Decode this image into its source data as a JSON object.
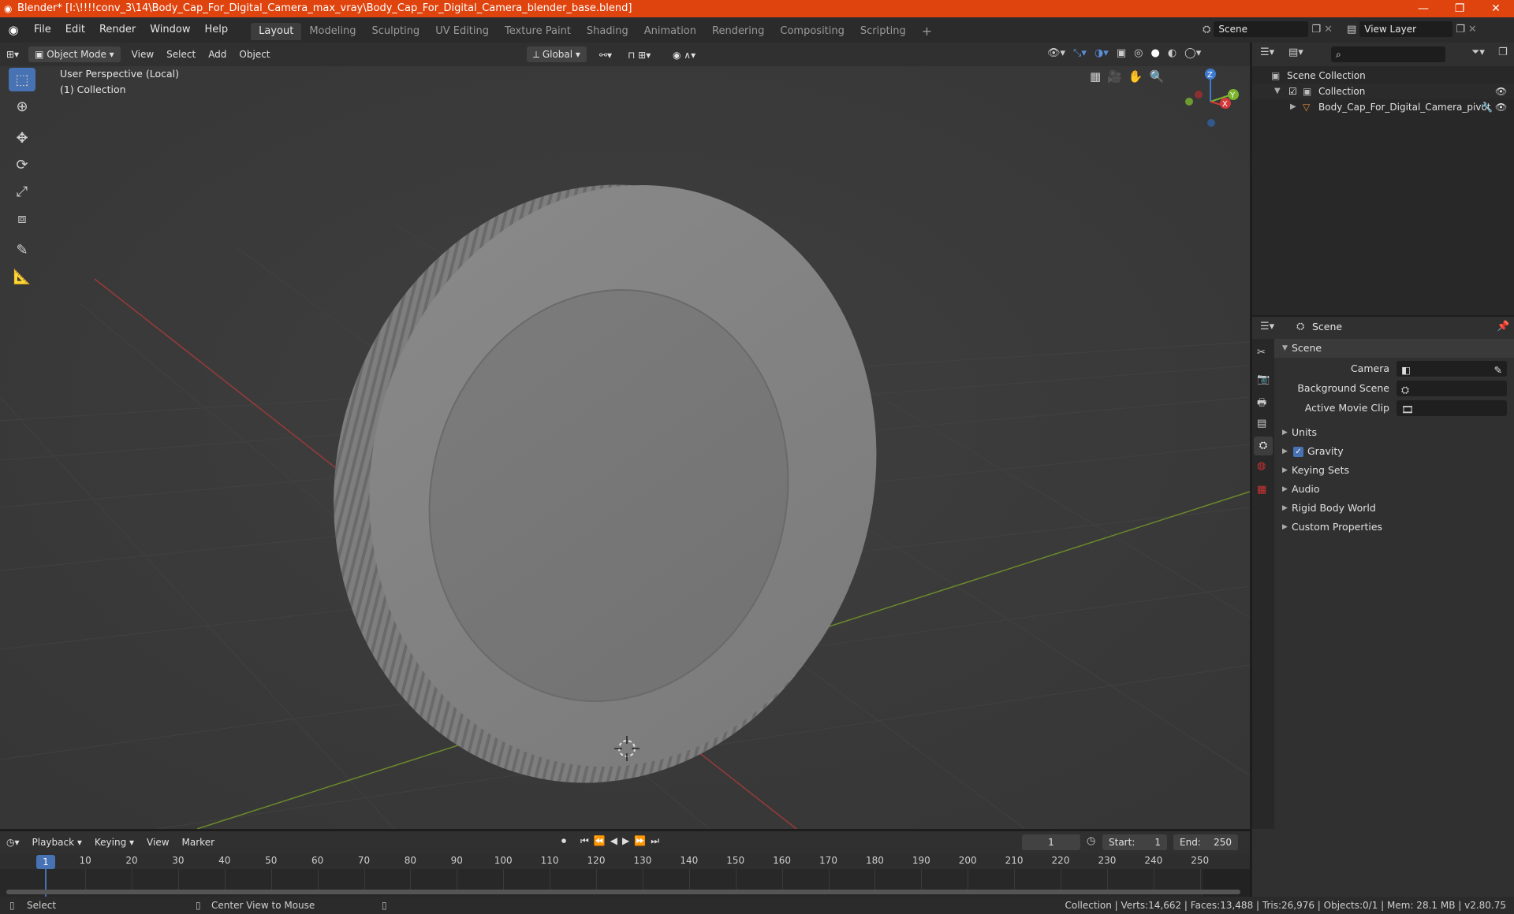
{
  "window": {
    "title": "Blender* [I:\\!!!!conv_3\\14\\Body_Cap_For_Digital_Camera_max_vray\\Body_Cap_For_Digital_Camera_blender_base.blend]",
    "minimize": "—",
    "restore": "❐",
    "close": "✕"
  },
  "menu": {
    "items": [
      "File",
      "Edit",
      "Render",
      "Window",
      "Help"
    ]
  },
  "workspaces": [
    "Layout",
    "Modeling",
    "Sculpting",
    "UV Editing",
    "Texture Paint",
    "Shading",
    "Animation",
    "Rendering",
    "Compositing",
    "Scripting"
  ],
  "scene_field": "Scene",
  "view_layer_field": "View Layer",
  "viewport_header": {
    "mode": "Object Mode",
    "menus": [
      "View",
      "Select",
      "Add",
      "Object"
    ],
    "transform": "Global"
  },
  "viewport": {
    "perspective": "User Perspective (Local)",
    "collection": "(1) Collection",
    "gizmo": {
      "z": "Z",
      "y": "Y",
      "x": "X"
    }
  },
  "outliner": {
    "root": "Scene Collection",
    "collection": "Collection",
    "object": "Body_Cap_For_Digital_Camera_pivot"
  },
  "properties": {
    "header": "Scene",
    "panel": "Scene",
    "camera_label": "Camera",
    "background_label": "Background Scene",
    "movie_clip_label": "Active Movie Clip",
    "sections": [
      "Units",
      "Gravity",
      "Keying Sets",
      "Audio",
      "Rigid Body World",
      "Custom Properties"
    ]
  },
  "timeline": {
    "menus": [
      "Playback",
      "Keying",
      "View",
      "Marker"
    ],
    "current_frame": "1",
    "start_label": "Start:",
    "start": "1",
    "end_label": "End:",
    "end": "250",
    "ticks": [
      "1",
      "10",
      "20",
      "30",
      "40",
      "50",
      "60",
      "70",
      "80",
      "90",
      "100",
      "110",
      "120",
      "130",
      "140",
      "150",
      "160",
      "170",
      "180",
      "190",
      "200",
      "210",
      "220",
      "230",
      "240",
      "250"
    ]
  },
  "status": {
    "select": "Select",
    "center_view": "Center View to Mouse",
    "stats": "Collection | Verts:14,662 | Faces:13,488 | Tris:26,976 | Objects:0/1 | Mem: 28.1 MB | v2.80.75"
  }
}
